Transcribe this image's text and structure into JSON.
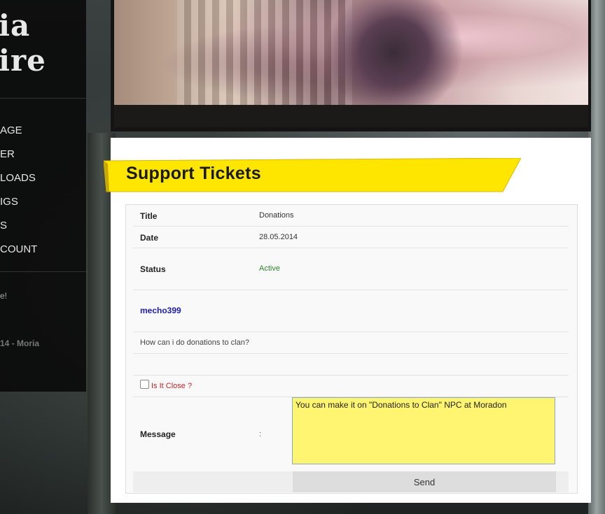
{
  "sidebar": {
    "logo_line1": "ia",
    "logo_line2": "ire",
    "nav": [
      {
        "label": "AGE"
      },
      {
        "label": "ER"
      },
      {
        "label": "LOADS"
      },
      {
        "label": "IGS"
      },
      {
        "label": "S"
      },
      {
        "label": "COUNT"
      }
    ],
    "note1": "e!",
    "note2": "14 - Moria"
  },
  "page": {
    "title": "Support Tickets"
  },
  "ticket": {
    "title_label": "Title",
    "title_value": "Donations",
    "date_label": "Date",
    "date_value": "28.05.2014",
    "status_label": "Status",
    "status_value": "Active",
    "username": "mecho399",
    "body": "How can i do donations to clan?",
    "close_label": "Is It Close ?",
    "message_label": "Message",
    "message_colon": ":",
    "message_value": "You can make it on \"Donations to Clan\" NPC at Moradon",
    "send_label": "Send"
  },
  "colors": {
    "ribbon": "#ffe600",
    "status_active": "#2c8a2c",
    "username": "#1f1fb0",
    "message_bg": "#fff570"
  }
}
